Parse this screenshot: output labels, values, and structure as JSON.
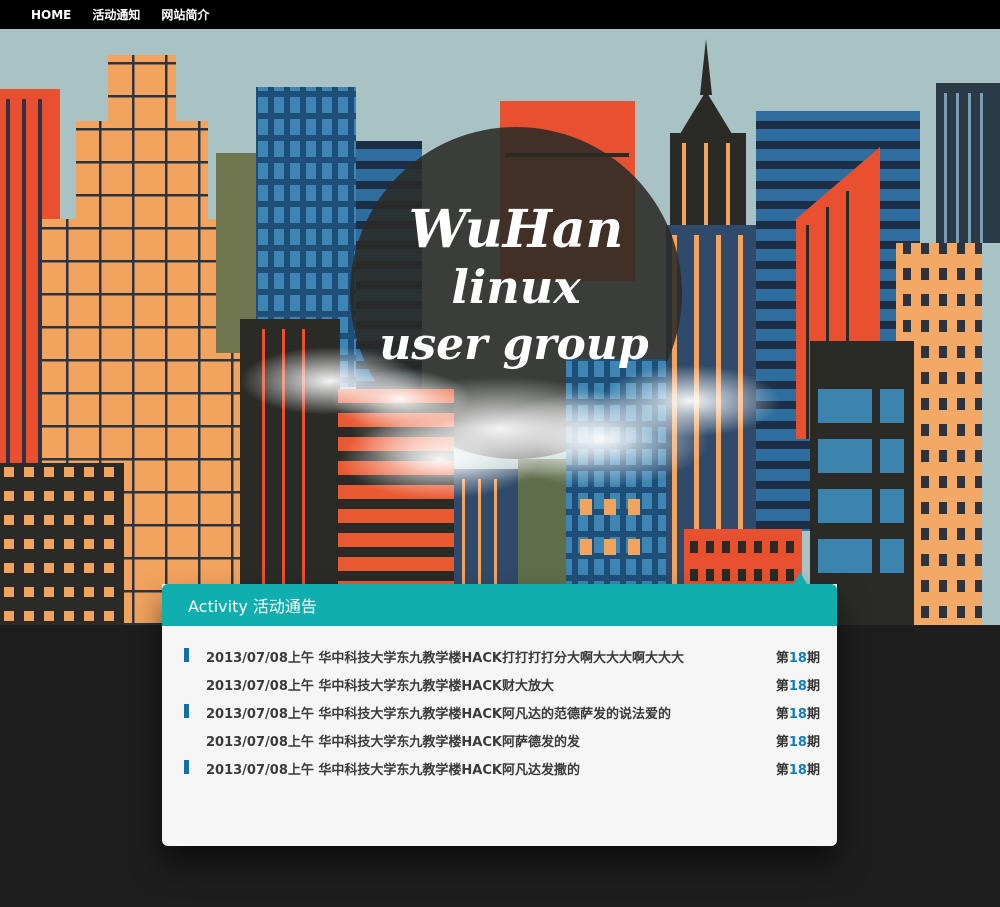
{
  "nav": {
    "items": [
      {
        "label": "HOME"
      },
      {
        "label": "活动通知"
      },
      {
        "label": "网站简介"
      }
    ]
  },
  "hero": {
    "logo_lines": [
      "WuHan",
      "linux",
      "user group"
    ]
  },
  "activity": {
    "title": "Activity 活动通告",
    "issue_prefix": "第",
    "issue_suffix": "期",
    "items": [
      {
        "text": "2013/07/08上午 华中科技大学东九教学楼HACK打打打打分大啊大大大啊大大大",
        "issue": "18",
        "marked": true
      },
      {
        "text": "2013/07/08上午 华中科技大学东九教学楼HACK财大放大",
        "issue": "18",
        "marked": false
      },
      {
        "text": "2013/07/08上午 华中科技大学东九教学楼HACK阿凡达的范德萨发的说法爱的",
        "issue": "18",
        "marked": true
      },
      {
        "text": "2013/07/08上午 华中科技大学东九教学楼HACK阿萨德发的发",
        "issue": "18",
        "marked": false
      },
      {
        "text": "2013/07/08上午 华中科技大学东九教学楼HACK阿凡达发撒的",
        "issue": "18",
        "marked": true
      }
    ]
  },
  "colors": {
    "teal": "#10aeae",
    "marker_blue": "#0f6fa6",
    "issue_blue": "#0f7fc2",
    "sky": "#a9c2c4",
    "orange": "#f2a35e",
    "red": "#e8502f",
    "navy": "#273a52",
    "dark": "#2a2a26"
  }
}
